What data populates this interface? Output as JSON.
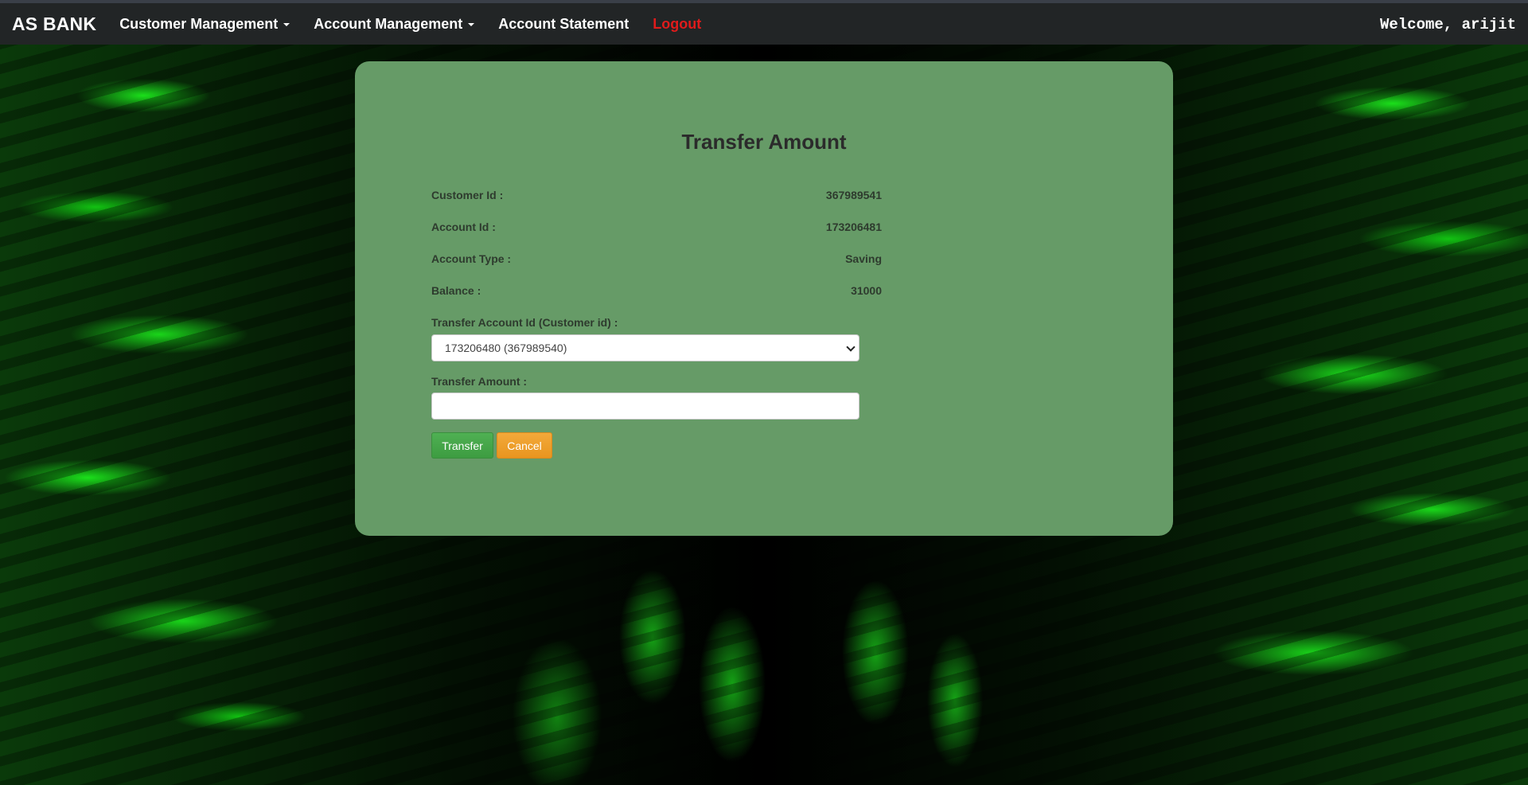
{
  "navbar": {
    "brand": "AS BANK",
    "items": [
      {
        "label": "Customer Management",
        "dropdown": true
      },
      {
        "label": "Account Management",
        "dropdown": true
      },
      {
        "label": "Account Statement",
        "dropdown": false
      },
      {
        "label": "Logout",
        "dropdown": false
      }
    ],
    "welcome": "Welcome, arijit"
  },
  "form": {
    "title": "Transfer Amount",
    "fields": [
      {
        "label": "Customer Id :",
        "value": "367989541"
      },
      {
        "label": "Account Id :",
        "value": "173206481"
      },
      {
        "label": "Account Type :",
        "value": "Saving"
      },
      {
        "label": "Balance :",
        "value": "31000"
      }
    ],
    "transfer_account_label": "Transfer Account Id (Customer id) :",
    "transfer_account_selected": "173206480 (367989540)",
    "transfer_amount_label": "Transfer Amount :",
    "transfer_amount_value": "",
    "transfer_button": "Transfer",
    "cancel_button": "Cancel"
  },
  "colors": {
    "navbar_bg": "#222526",
    "panel_bg": "#669b67",
    "logout": "#e01b1b",
    "transfer_btn": "#45a649",
    "cancel_btn": "#ee9f2c"
  }
}
